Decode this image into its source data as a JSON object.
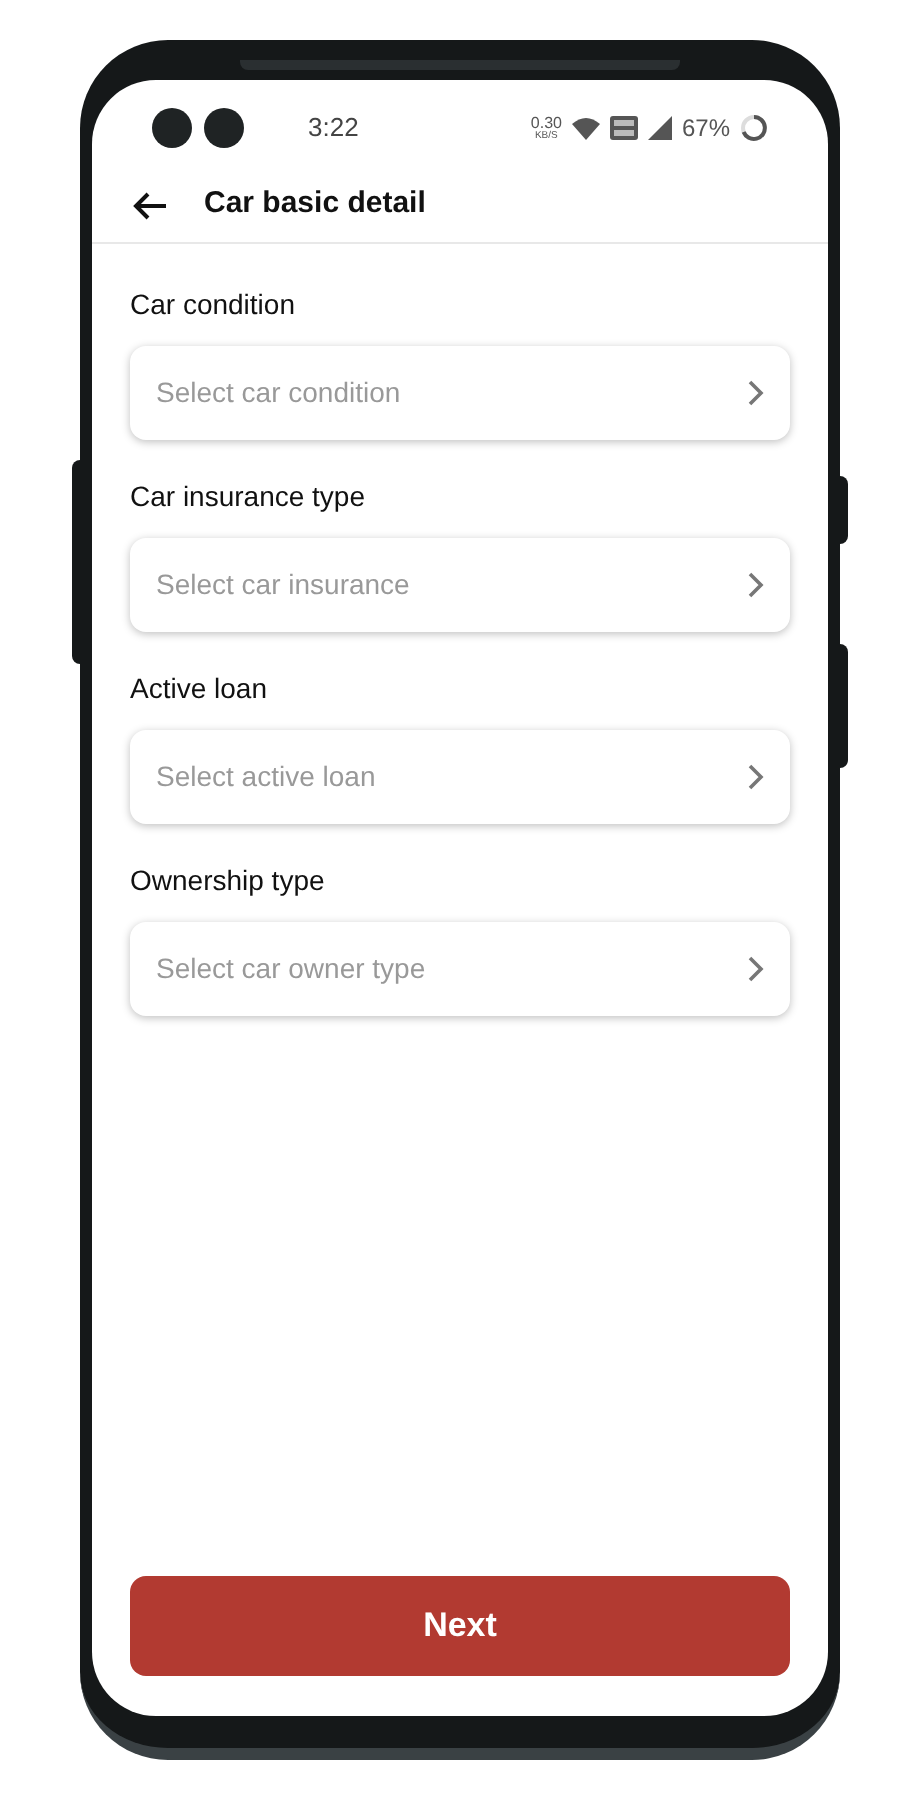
{
  "status_bar": {
    "time": "3:22",
    "speed": "0.30",
    "speed_unit": "KB/S",
    "battery": "67%"
  },
  "header": {
    "title": "Car basic detail"
  },
  "fields": [
    {
      "label": "Car condition",
      "placeholder": "Select car condition"
    },
    {
      "label": "Car insurance type",
      "placeholder": "Select car insurance"
    },
    {
      "label": "Active loan",
      "placeholder": "Select active loan"
    },
    {
      "label": "Ownership type",
      "placeholder": "Select car owner type"
    }
  ],
  "next_button": "Next"
}
